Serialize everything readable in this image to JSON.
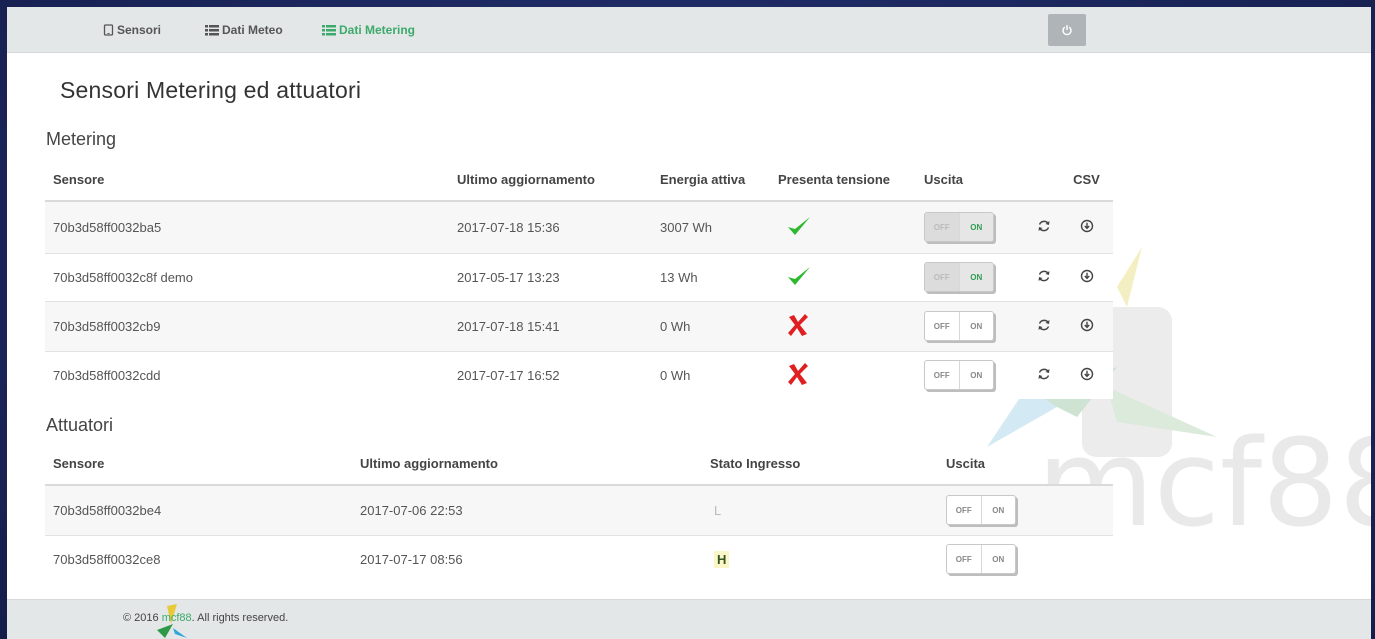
{
  "nav": {
    "items": [
      {
        "label": "Sensori",
        "icon": "tablet-icon"
      },
      {
        "label": "Dati Meteo",
        "icon": "list-icon"
      },
      {
        "label": "Dati Metering",
        "icon": "list-icon",
        "active": true
      }
    ],
    "power_icon": "power-icon"
  },
  "page": {
    "title": "Sensori Metering ed attuatori"
  },
  "metering": {
    "title": "Metering",
    "columns": [
      "Sensore",
      "Ultimo aggiornamento",
      "Energia attiva",
      "Presenta tensione",
      "Uscita",
      "CSV"
    ],
    "rows": [
      {
        "sensor": "70b3d58ff0032ba5",
        "updated": "2017-07-18 15:36",
        "energy": "3007 Wh",
        "voltage": true,
        "output": "on"
      },
      {
        "sensor": "70b3d58ff0032c8f demo",
        "updated": "2017-05-17 13:23",
        "energy": "13 Wh",
        "voltage": true,
        "output": "on"
      },
      {
        "sensor": "70b3d58ff0032cb9",
        "updated": "2017-07-18 15:41",
        "energy": "0 Wh",
        "voltage": false,
        "output": "off"
      },
      {
        "sensor": "70b3d58ff0032cdd",
        "updated": "2017-07-17 16:52",
        "energy": "0 Wh",
        "voltage": false,
        "output": "off"
      }
    ]
  },
  "actuators": {
    "title": "Attuatori",
    "columns": [
      "Sensore",
      "Ultimo aggiornamento",
      "Stato Ingresso",
      "Uscita"
    ],
    "rows": [
      {
        "sensor": "70b3d58ff0032be4",
        "updated": "2017-07-06 22:53",
        "state": "L"
      },
      {
        "sensor": "70b3d58ff0032ce8",
        "updated": "2017-07-17 08:56",
        "state": "H"
      }
    ]
  },
  "toggle": {
    "off": "OFF",
    "on": "ON"
  },
  "footer": {
    "prefix": "© 2016 ",
    "brand": "mcf88",
    "suffix": ". All rights reserved."
  },
  "watermark": {
    "text": "mcf88"
  },
  "colors": {
    "accent": "#3caa6a",
    "check": "#2eb82e",
    "cross": "#e02020",
    "navbar": "#e4e7e8",
    "background": "#1d2860"
  }
}
